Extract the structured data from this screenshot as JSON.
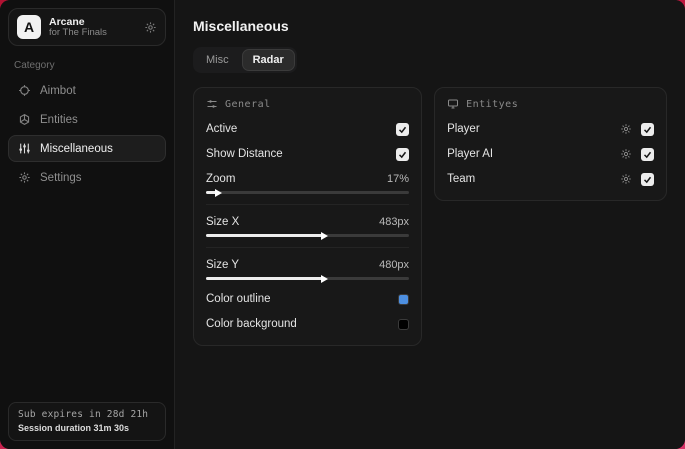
{
  "window": {
    "accent_color": "#c41d47"
  },
  "sidebar": {
    "brand": {
      "logo_letter": "A",
      "title": "Arcane",
      "subtitle": "for The Finals"
    },
    "category_label": "Category",
    "items": [
      {
        "label": "Aimbot",
        "icon": "crosshair-icon",
        "selected": false
      },
      {
        "label": "Entities",
        "icon": "entities-icon",
        "selected": false
      },
      {
        "label": "Miscellaneous",
        "icon": "sliders-icon",
        "selected": true
      },
      {
        "label": "Settings",
        "icon": "gear-icon",
        "selected": false
      }
    ],
    "footer": {
      "line1": "Sub expires in 28d 21h",
      "line2": "Session duration 31m 30s"
    }
  },
  "main": {
    "title": "Miscellaneous",
    "tabs": [
      {
        "label": "Misc",
        "selected": false
      },
      {
        "label": "Radar",
        "selected": true
      }
    ],
    "general_panel": {
      "title": "General",
      "active": {
        "label": "Active",
        "checked": true
      },
      "show_distance": {
        "label": "Show Distance",
        "checked": true
      },
      "zoom": {
        "label": "Zoom",
        "value": "17%",
        "fill": "6%"
      },
      "size_x": {
        "label": "Size X",
        "value": "483px",
        "fill": "58%"
      },
      "size_y": {
        "label": "Size Y",
        "value": "480px",
        "fill": "58%"
      },
      "color_outline": {
        "label": "Color outline",
        "color": "#4d8fe0"
      },
      "color_background": {
        "label": "Color background",
        "color": "#000000"
      }
    },
    "entities_panel": {
      "title": "Entityes",
      "rows": [
        {
          "label": "Player",
          "checked": true
        },
        {
          "label": "Player AI",
          "checked": true
        },
        {
          "label": "Team",
          "checked": true
        }
      ]
    }
  }
}
